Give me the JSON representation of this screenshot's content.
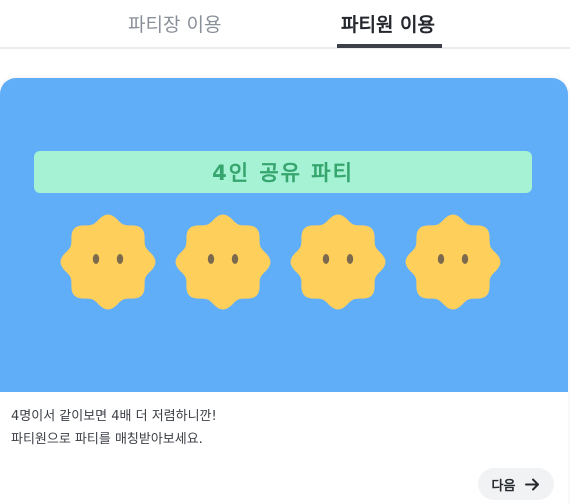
{
  "tabs": [
    {
      "label": "파티장 이용",
      "active": false
    },
    {
      "label": "파티원 이용",
      "active": true
    }
  ],
  "banner": {
    "title": "4인 공유 파티",
    "member_count": 4,
    "colors": {
      "background": "#61aef8",
      "title_bar": "#a5f3d4",
      "title_text": "#36a56e",
      "character": "#ffcf5c"
    }
  },
  "description": {
    "line1": "4명이서 같이보면 4배 더 저렴하니깐!",
    "line2": "파티원으로 파티를 매칭받아보세요."
  },
  "next_button": {
    "label": "다음",
    "icon": "arrow-right-icon"
  }
}
